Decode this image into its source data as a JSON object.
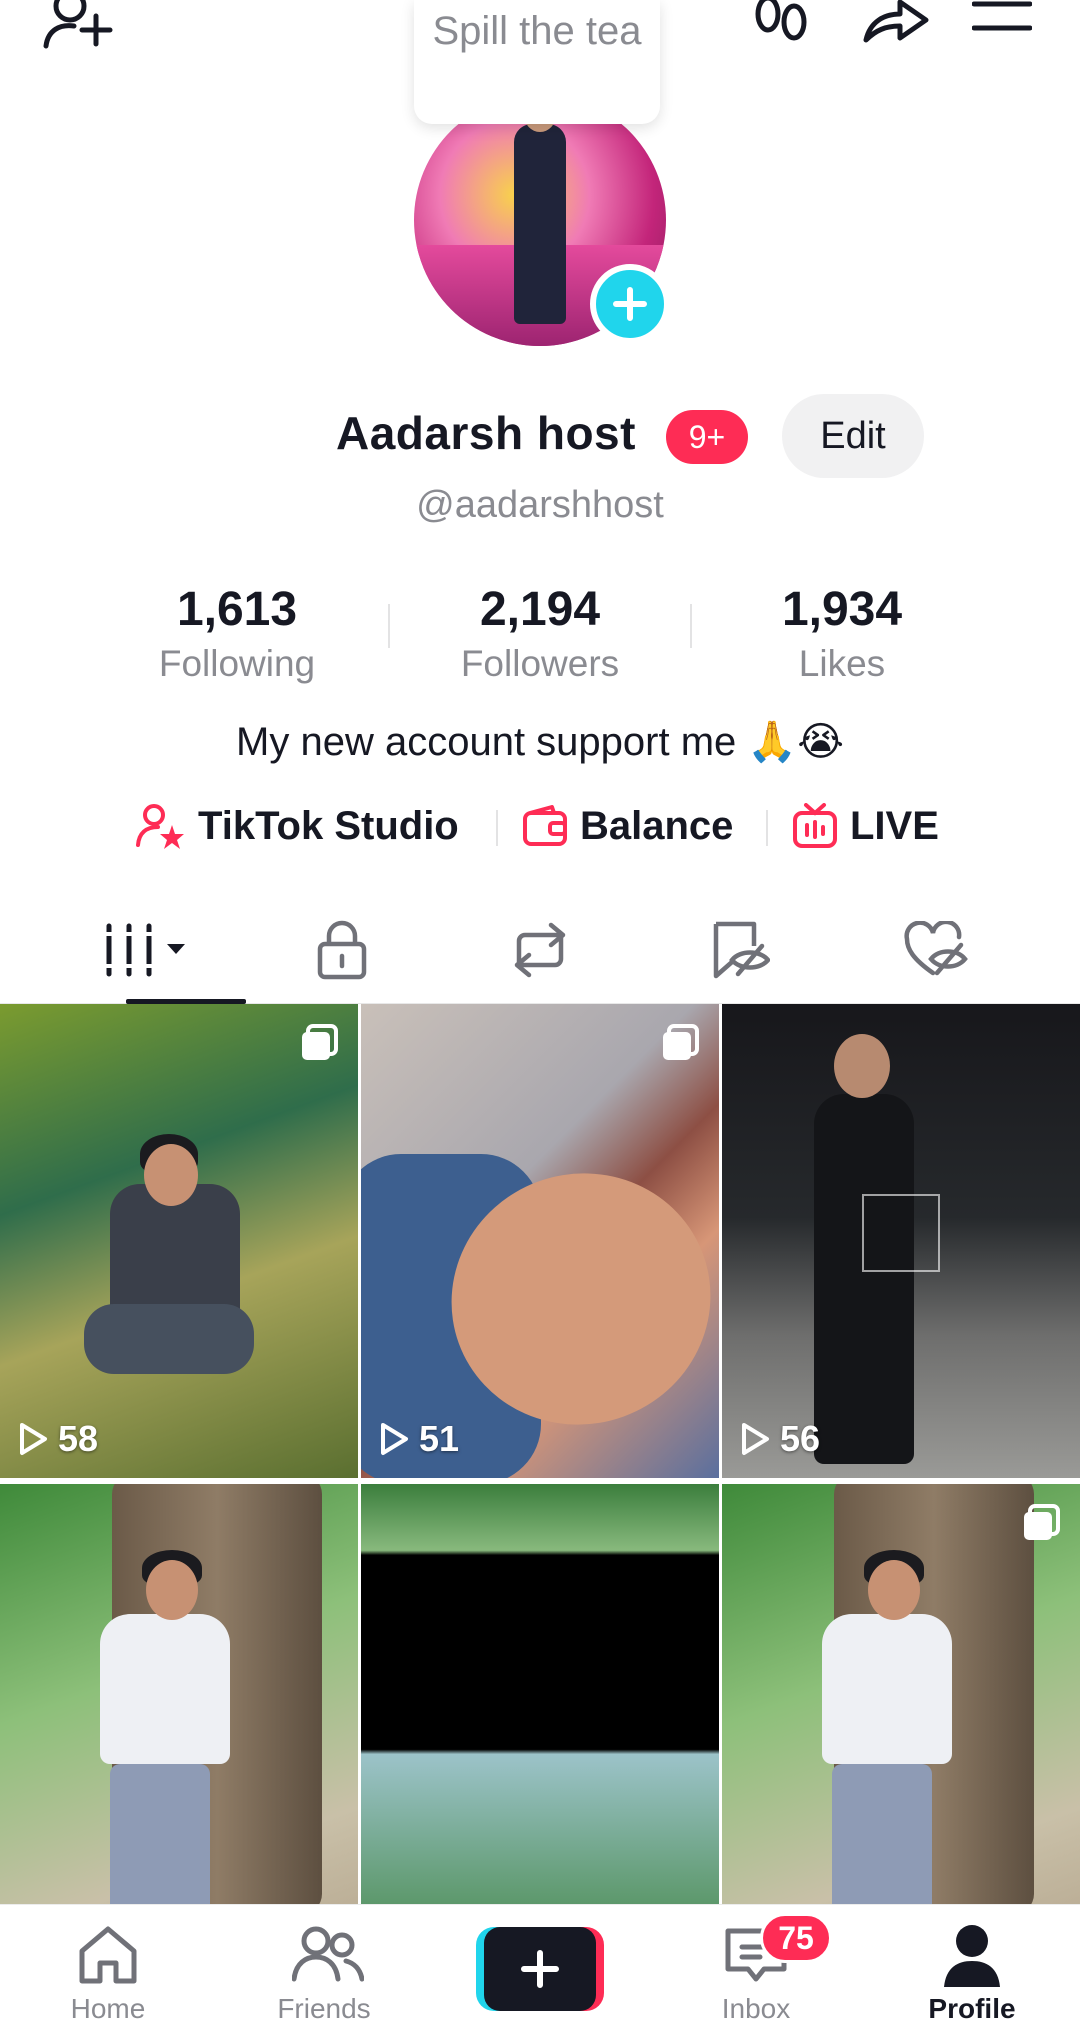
{
  "header": {
    "tooltip_text": "Spill the tea",
    "icons": [
      "add-friend-icon",
      "footprints-icon",
      "share-icon",
      "menu-icon"
    ]
  },
  "profile": {
    "display_name": "Aadarsh host",
    "notification_badge": "9+",
    "edit_label": "Edit",
    "username": "@aadarshhost",
    "bio": "My new account support me 🙏😭"
  },
  "stats": [
    {
      "value": "1,613",
      "label": "Following"
    },
    {
      "value": "2,194",
      "label": "Followers"
    },
    {
      "value": "1,934",
      "label": "Likes"
    }
  ],
  "links": [
    {
      "label": "TikTok Studio",
      "icon": "creator-icon"
    },
    {
      "label": "Balance",
      "icon": "wallet-icon"
    },
    {
      "label": "LIVE",
      "icon": "live-tv-icon"
    }
  ],
  "tabs": [
    {
      "icon": "videos-grid-icon",
      "active": true
    },
    {
      "icon": "lock-icon",
      "active": false
    },
    {
      "icon": "repost-icon",
      "active": false
    },
    {
      "icon": "favorites-hidden-icon",
      "active": false
    },
    {
      "icon": "liked-hidden-icon",
      "active": false
    }
  ],
  "videos": [
    {
      "views": "58",
      "multi": true
    },
    {
      "views": "51",
      "multi": true
    },
    {
      "views": "56",
      "multi": false
    },
    {
      "views": "",
      "multi": false
    },
    {
      "views": "",
      "multi": false
    },
    {
      "views": "",
      "multi": true
    }
  ],
  "bottom_nav": {
    "items": [
      {
        "label": "Home",
        "icon": "home-icon"
      },
      {
        "label": "Friends",
        "icon": "friends-icon"
      },
      {
        "label": "",
        "icon": "create-plus-icon"
      },
      {
        "label": "Inbox",
        "icon": "inbox-icon"
      },
      {
        "label": "Profile",
        "icon": "profile-icon"
      }
    ],
    "inbox_badge": "75",
    "active": "Profile"
  },
  "colors": {
    "accent_red": "#fe2c55",
    "accent_cyan": "#20d5ec",
    "text_primary": "#161823",
    "text_secondary": "#8a8b91"
  }
}
